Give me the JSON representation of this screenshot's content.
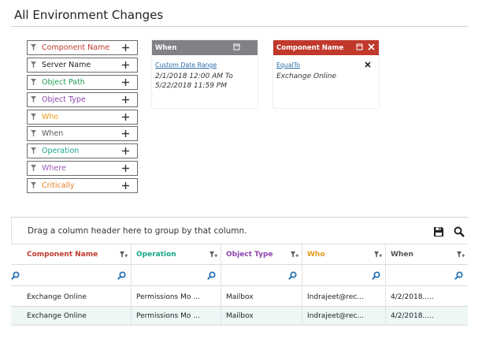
{
  "page": {
    "title": "All Environment Changes"
  },
  "colors": {
    "component": "#c0392b",
    "server": "#222222",
    "object_path": "#1f9e55",
    "object_type": "#8e44ad",
    "who": "#e69a1a",
    "when": "#555555",
    "operation": "#17a589",
    "where": "#9b59b6",
    "critically": "#e67e22",
    "when_card_header": "#808285",
    "component_card_header": "#c0392b"
  },
  "filters": [
    {
      "label": "Component Name",
      "color": "#c0392b"
    },
    {
      "label": "Server Name",
      "color": "#222222"
    },
    {
      "label": "Object Path",
      "color": "#1f9e55"
    },
    {
      "label": "Object Type",
      "color": "#8e44ad"
    },
    {
      "label": "Who",
      "color": "#e69a1a"
    },
    {
      "label": "When",
      "color": "#555555"
    },
    {
      "label": "Operation",
      "color": "#17a589"
    },
    {
      "label": "Where",
      "color": "#9b59b6"
    },
    {
      "label": "Critically",
      "color": "#e67e22"
    }
  ],
  "cards": {
    "when": {
      "header": "When",
      "link": "Custom Date Range",
      "value": "2/1/2018 12:00 AM To 5/22/2018 11:59 PM"
    },
    "component": {
      "header": "Component Name",
      "link": "EqualTo",
      "value": "Exchange Online"
    }
  },
  "grid": {
    "group_hint": "Drag a column header here to group by that column.",
    "columns": [
      {
        "label": "Component Name",
        "color": "#c0392b"
      },
      {
        "label": "Operation",
        "color": "#17a589"
      },
      {
        "label": "Object Type",
        "color": "#8e44ad"
      },
      {
        "label": "Who",
        "color": "#e69a1a"
      },
      {
        "label": "When",
        "color": "#555555"
      }
    ],
    "rows": [
      [
        "Exchange Online",
        "Permissions Mo ...",
        "Mailbox",
        "Indrajeet@rec...",
        "4/2/2018....."
      ],
      [
        "Exchange Online",
        "Permissions Mo ...",
        "Mailbox",
        "Indrajeet@rec...",
        "4/2/2018....."
      ]
    ]
  }
}
